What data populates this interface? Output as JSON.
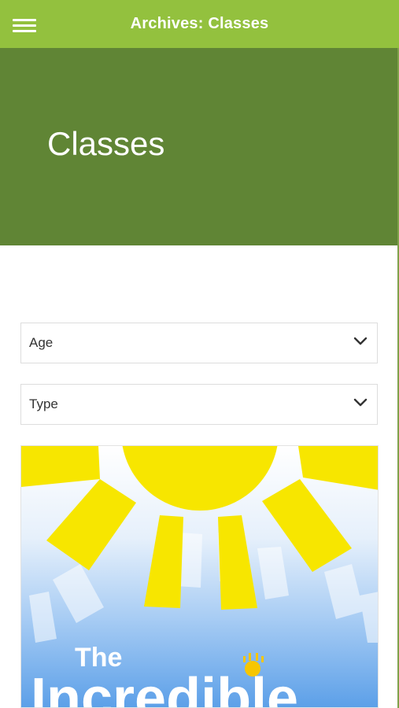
{
  "header": {
    "title": "Archives: Classes",
    "menu_icon": "hamburger-menu-icon",
    "background": "#93c13e"
  },
  "hero": {
    "title": "Classes",
    "background": "#608535"
  },
  "filters": {
    "age_label": "Age",
    "type_label": "Type",
    "chevron_icon": "chevron-down-icon"
  },
  "card": {
    "image_text_1": "The",
    "image_text_2": "Incredible",
    "sun_color": "#f7e600",
    "sky_top": "#ffffff",
    "sky_bottom": "#5b9fe8"
  }
}
